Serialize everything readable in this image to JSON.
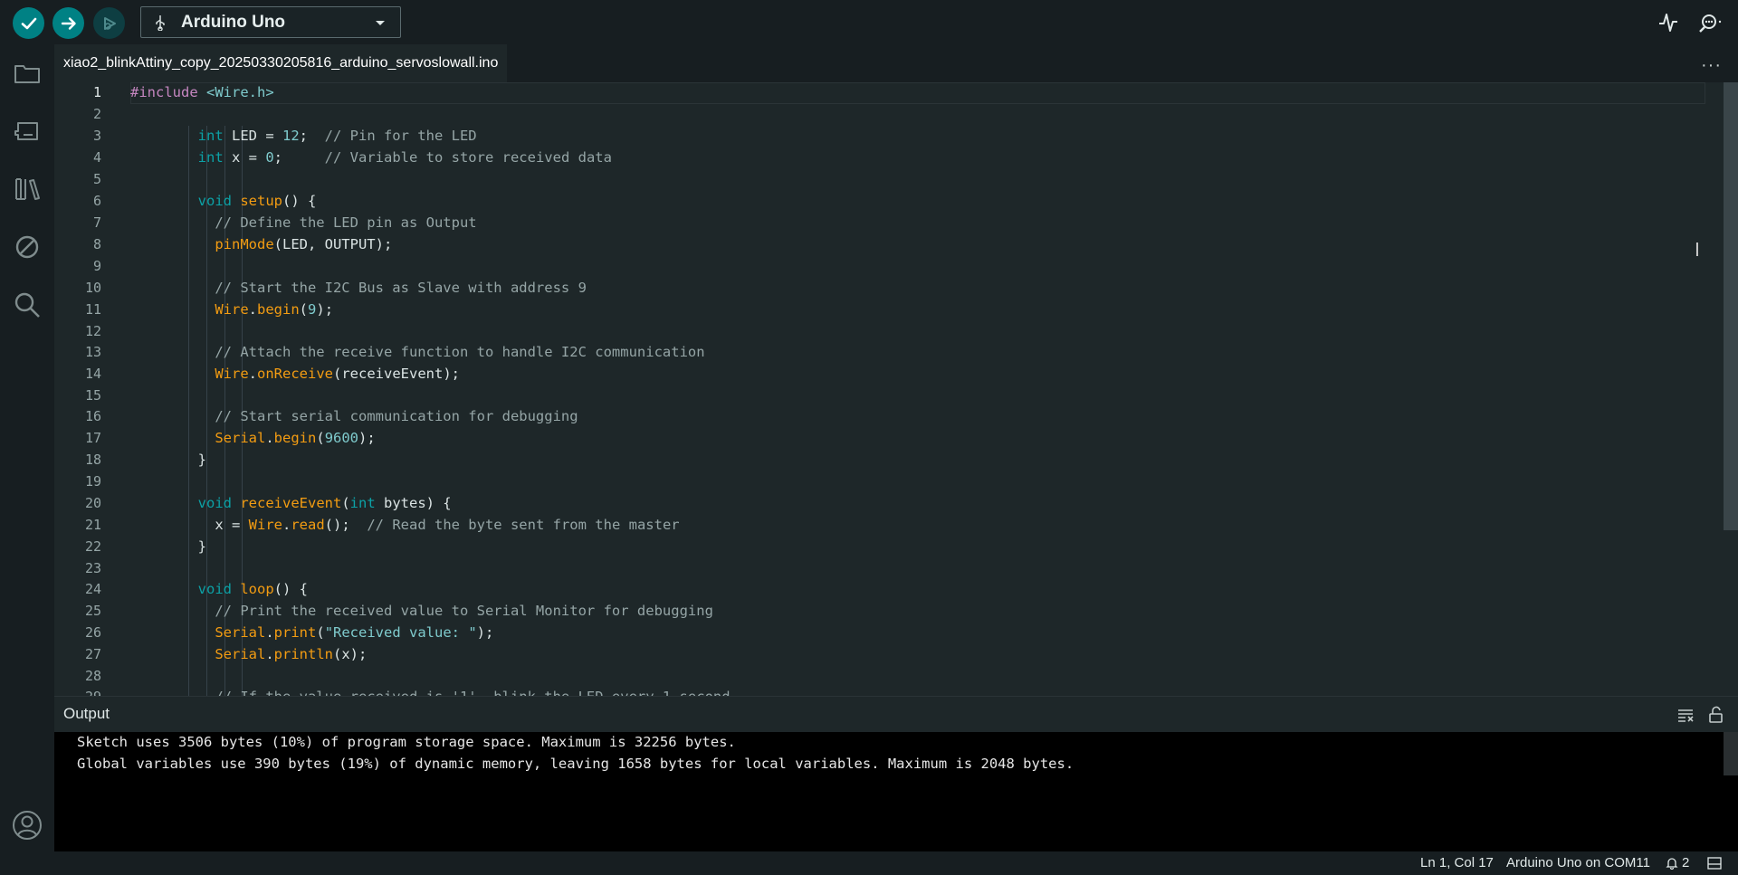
{
  "toolbar": {
    "board_name": "Arduino Uno",
    "verify_icon": "check-icon",
    "upload_icon": "arrow-right-icon",
    "debug_icon": "debug-icon",
    "plotter_icon": "serial-plotter-icon",
    "monitor_icon": "serial-monitor-icon"
  },
  "sidebar": {
    "items": [
      {
        "name": "sketchbook",
        "icon": "folder-icon"
      },
      {
        "name": "boards-manager",
        "icon": "board-icon"
      },
      {
        "name": "library-manager",
        "icon": "library-icon"
      },
      {
        "name": "debug",
        "icon": "no-debug-icon"
      },
      {
        "name": "search",
        "icon": "search-icon"
      }
    ],
    "account_icon": "account-icon"
  },
  "tab": {
    "filename": "xiao2_blinkAttiny_copy_20250330205816_arduino_servoslowall.ino",
    "more": "···"
  },
  "editor": {
    "line_numbers": [
      "1",
      "2",
      "3",
      "4",
      "5",
      "6",
      "7",
      "8",
      "9",
      "10",
      "11",
      "12",
      "13",
      "14",
      "15",
      "16",
      "17",
      "18",
      "19",
      "20",
      "21",
      "22",
      "23",
      "24",
      "25",
      "26",
      "27",
      "28",
      "29"
    ]
  },
  "output": {
    "title": "Output",
    "lines": [
      "Sketch uses 3506 bytes (10%) of program storage space. Maximum is 32256 bytes.",
      "Global variables use 390 bytes (19%) of dynamic memory, leaving 1658 bytes for local variables. Maximum is 2048 bytes."
    ]
  },
  "status": {
    "cursor": "Ln 1, Col 17",
    "board_port": "Arduino Uno on COM11",
    "notifications": "2"
  }
}
